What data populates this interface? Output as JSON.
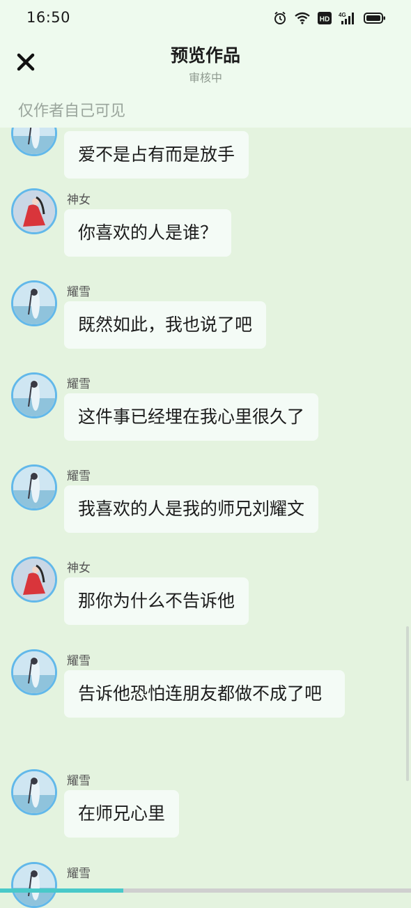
{
  "status_bar": {
    "time": "16:50",
    "icons": [
      "alarm-icon",
      "wifi-icon",
      "hd-icon",
      "signal-4g-icon",
      "battery-icon"
    ],
    "network_label": "4G",
    "hd_label": "HD"
  },
  "header": {
    "title": "预览作品",
    "subtitle": "审核中",
    "close_icon": "close-icon",
    "visibility_note": "仅作者自己可见"
  },
  "colors": {
    "background": "#e4f3df",
    "header_bg": "#eefaee",
    "bubble_bg": "#f4fbf6",
    "avatar_border": "#62b8ea",
    "progress": "#49c9c9"
  },
  "messages": [
    {
      "sender": "",
      "avatar": "yaoxue-avatar",
      "text": "爱不是占有而是放手"
    },
    {
      "sender": "神女",
      "avatar": "shennv-avatar",
      "text": "你喜欢的人是谁？"
    },
    {
      "sender": "耀雪",
      "avatar": "yaoxue-avatar",
      "text": "既然如此，我也说了吧"
    },
    {
      "sender": "耀雪",
      "avatar": "yaoxue-avatar",
      "text": "这件事已经埋在我心里很久了"
    },
    {
      "sender": "耀雪",
      "avatar": "yaoxue-avatar",
      "text": "我喜欢的人是我的师兄刘耀文"
    },
    {
      "sender": "神女",
      "avatar": "shennv-avatar",
      "text": "那你为什么不告诉他"
    },
    {
      "sender": "耀雪",
      "avatar": "yaoxue-avatar",
      "text": "告诉他恐怕连朋友都做不成了吧"
    },
    {
      "sender": "耀雪",
      "avatar": "yaoxue-avatar",
      "text": "在师兄心里"
    },
    {
      "sender": "耀雪",
      "avatar": "yaoxue-avatar",
      "text": ""
    }
  ],
  "progress": {
    "fraction": 0.3
  }
}
